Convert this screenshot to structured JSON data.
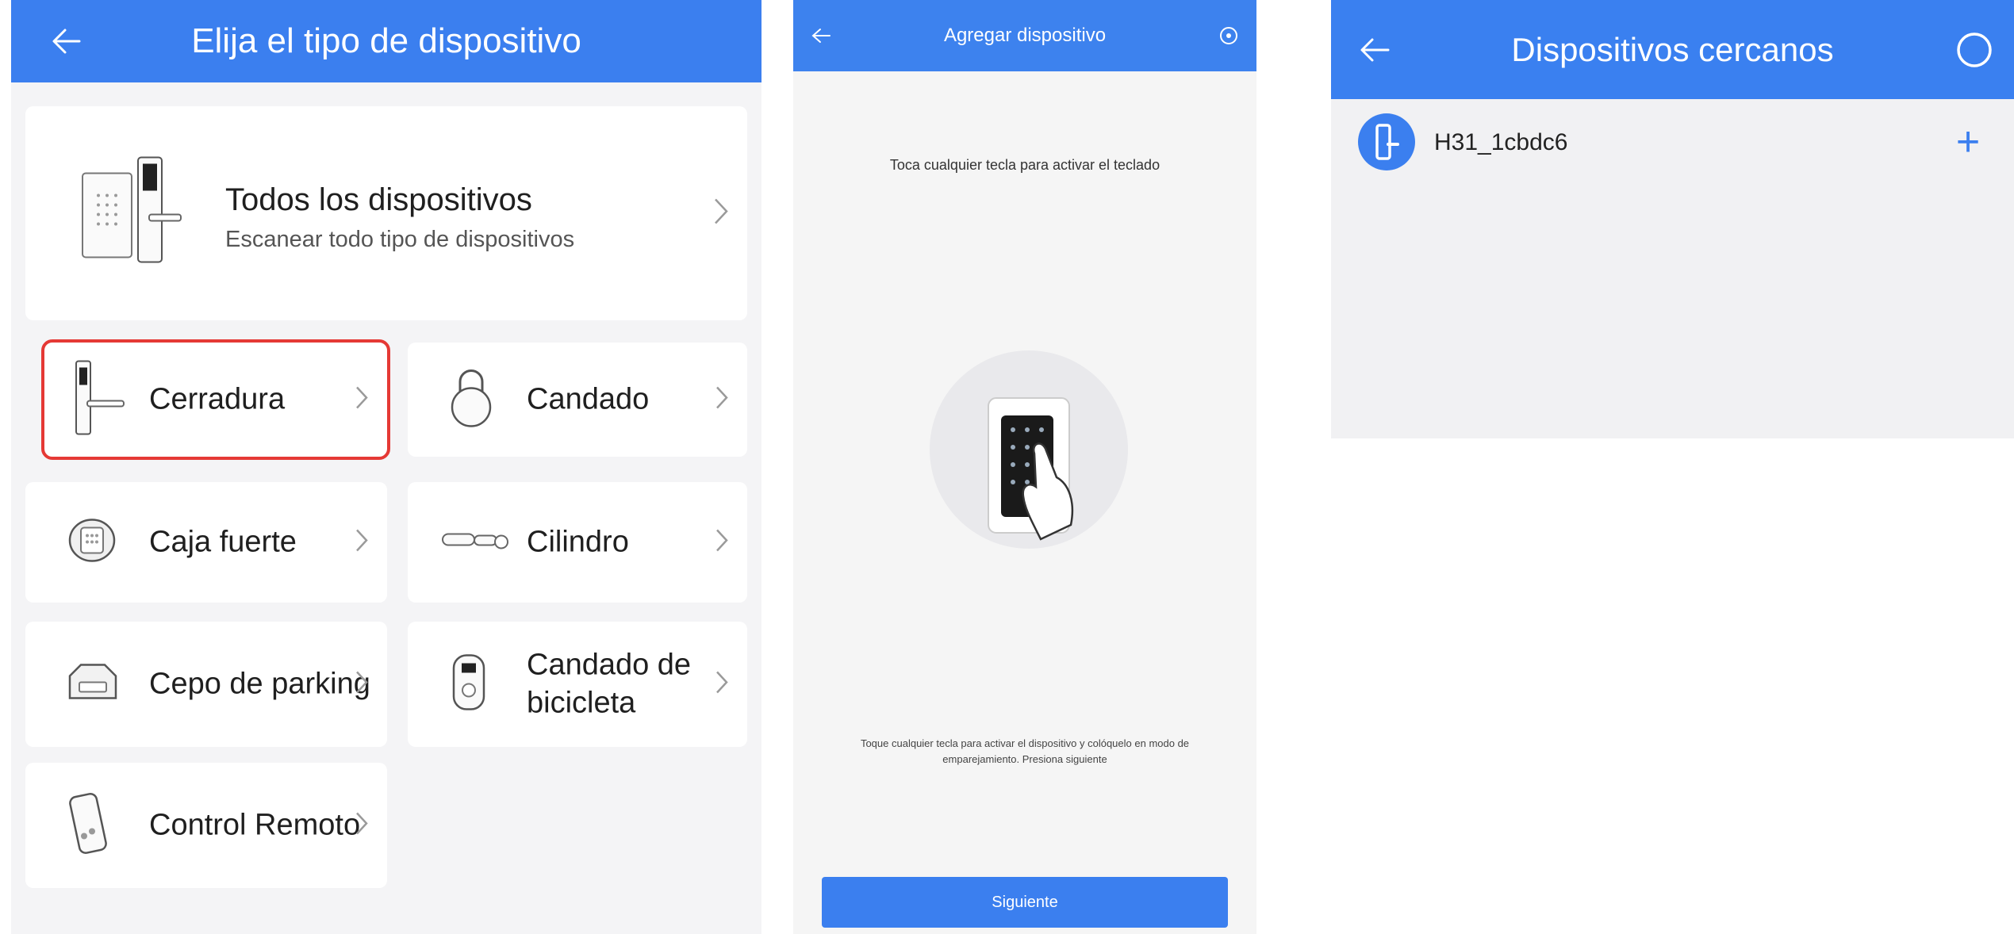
{
  "screen1": {
    "title": "Elija el tipo de dispositivo",
    "hero": {
      "title": "Todos los dispositivos",
      "subtitle": "Escanear todo tipo de dispositivos"
    },
    "items": [
      {
        "label": "Cerradura",
        "icon": "door-lock-icon",
        "selected": true
      },
      {
        "label": "Candado",
        "icon": "padlock-icon"
      },
      {
        "label": "Caja fuerte",
        "icon": "safe-icon"
      },
      {
        "label": "Cilindro",
        "icon": "cylinder-icon"
      },
      {
        "label": "Cepo de parking",
        "icon": "parking-lock-icon"
      },
      {
        "label": "Candado de bicicleta",
        "icon": "bike-lock-icon"
      },
      {
        "label": "Control Remoto",
        "icon": "remote-control-icon"
      }
    ]
  },
  "screen2": {
    "title": "Agregar dispositivo",
    "instruction_top": "Toca cualquier tecla para activar el teclado",
    "instruction_bottom": "Toque cualquier tecla para activar el dispositivo y colóquelo en modo de emparejamiento. Presiona siguiente",
    "next_button": "Siguiente"
  },
  "screen3": {
    "title": "Dispositivos cercanos",
    "device": {
      "name": "H31_1cbdc6",
      "icon": "door-lock-icon"
    },
    "add_icon": "+"
  },
  "colors": {
    "accent": "#3b7fef",
    "highlight": "#e53935",
    "background": "#f4f4f6"
  }
}
